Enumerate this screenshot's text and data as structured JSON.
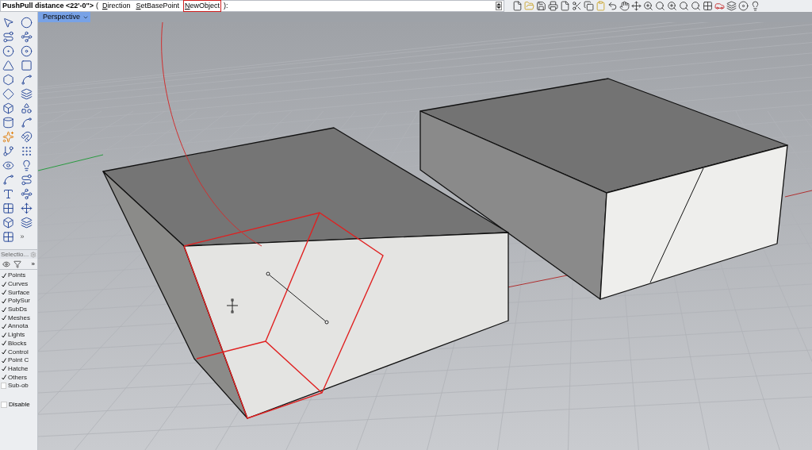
{
  "command": {
    "prompt": "PushPull distance <22'-0\">",
    "open": "(",
    "options": [
      {
        "label": "Direction",
        "highlighted": false
      },
      {
        "label": "SetBasePoint",
        "highlighted": false
      },
      {
        "label": "NewObject",
        "highlighted": true
      }
    ],
    "close": "):"
  },
  "viewport_tab": {
    "label": "Perspective",
    "selected": true
  },
  "toolbar_more": "»",
  "selection_panel": {
    "title": "Selectio...",
    "more": "»",
    "filters": [
      {
        "label": "Points",
        "checked": true
      },
      {
        "label": "Curves",
        "checked": true
      },
      {
        "label": "Surface",
        "checked": true
      },
      {
        "label": "PolySur",
        "checked": true
      },
      {
        "label": "SubDs",
        "checked": true
      },
      {
        "label": "Meshes",
        "checked": true
      },
      {
        "label": "Annota",
        "checked": true
      },
      {
        "label": "Lights",
        "checked": true
      },
      {
        "label": "Blocks",
        "checked": true
      },
      {
        "label": "Control",
        "checked": true
      },
      {
        "label": "Point C",
        "checked": true
      },
      {
        "label": "Hatche",
        "checked": true
      },
      {
        "label": "Others",
        "checked": true
      },
      {
        "label": "Sub-ob",
        "checked": false
      }
    ],
    "disable": {
      "label": "Disable",
      "checked": false
    }
  }
}
